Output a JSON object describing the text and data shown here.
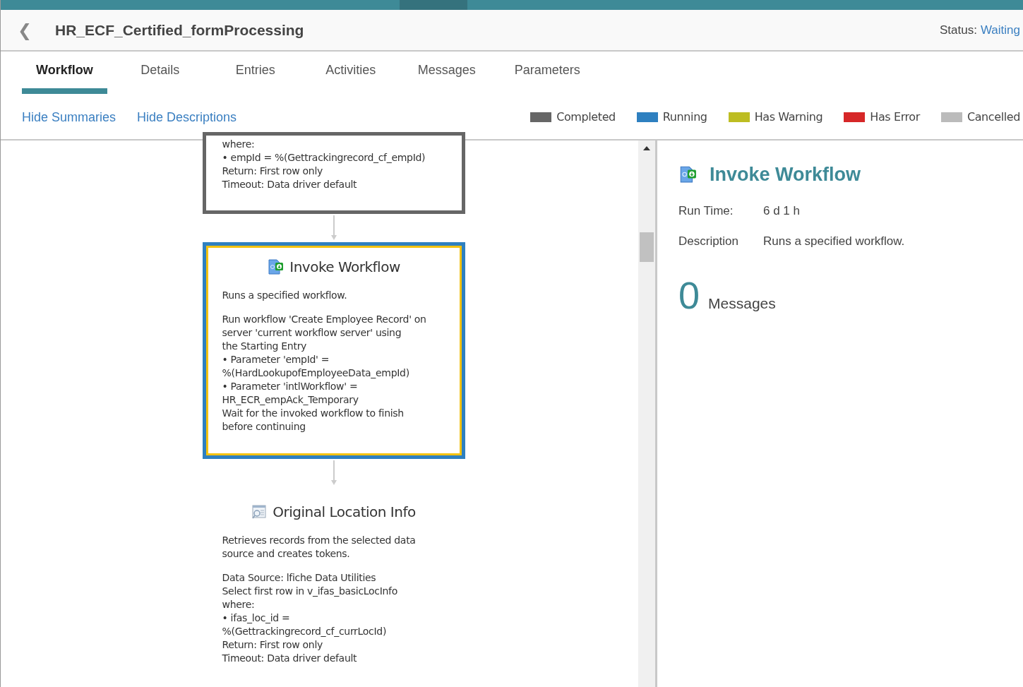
{
  "header": {
    "back_glyph": "❮",
    "title": "HR_ECF_Certified_formProcessing",
    "status_label": "Status:",
    "status_value": "Waiting"
  },
  "tabs": [
    {
      "label": "Workflow",
      "selected": true
    },
    {
      "label": "Details",
      "selected": false
    },
    {
      "label": "Entries",
      "selected": false
    },
    {
      "label": "Activities",
      "selected": false
    },
    {
      "label": "Messages",
      "selected": false
    },
    {
      "label": "Parameters",
      "selected": false
    }
  ],
  "toggles": [
    "Hide Summaries",
    "Hide Descriptions"
  ],
  "legend": [
    {
      "label": "Completed",
      "color": "#666666"
    },
    {
      "label": "Running",
      "color": "#2e80c0"
    },
    {
      "label": "Has Warning",
      "color": "#bdbd22"
    },
    {
      "label": "Has Error",
      "color": "#d62728"
    },
    {
      "label": "Cancelled",
      "color": "#bbbbbb"
    }
  ],
  "nodes": [
    {
      "completed": true,
      "selected": false,
      "paragraphs": [
        "where:\n• empId = %(Gettrackingrecord_cf_empId)\nReturn: First row only\nTimeout: Data driver default"
      ]
    },
    {
      "kind": "invoke",
      "running": true,
      "selected": true,
      "title": "Invoke Workflow",
      "paragraphs": [
        "Runs a specified workflow.",
        "Run workflow 'Create Employee Record' on\nserver 'current workflow server' using\nthe Starting Entry\n• Parameter 'empId' =\n%(HardLookupofEmployeeData_empId)\n• Parameter 'intlWorkflow' =\nHR_ECR_empAck_Temporary\nWait for the invoked workflow to finish\nbefore continuing"
      ]
    },
    {
      "kind": "query",
      "selected": false,
      "title": "Original Location Info",
      "paragraphs": [
        "Retrieves records from the selected data\nsource and creates tokens.",
        "Data Source: lfiche Data Utilities\nSelect first row in v_ifas_basicLocInfo\nwhere:\n• ifas_loc_id =\n%(Gettrackingrecord_cf_currLocId)\nReturn: First row only\nTimeout: Data driver default"
      ]
    }
  ],
  "details": {
    "title": "Invoke Workflow",
    "fields": [
      {
        "label": "Run Time:",
        "value": "6 d 1 h"
      },
      {
        "label": "Description",
        "value": "Runs a specified workflow."
      }
    ],
    "message_count": "0",
    "message_label": "Messages"
  }
}
